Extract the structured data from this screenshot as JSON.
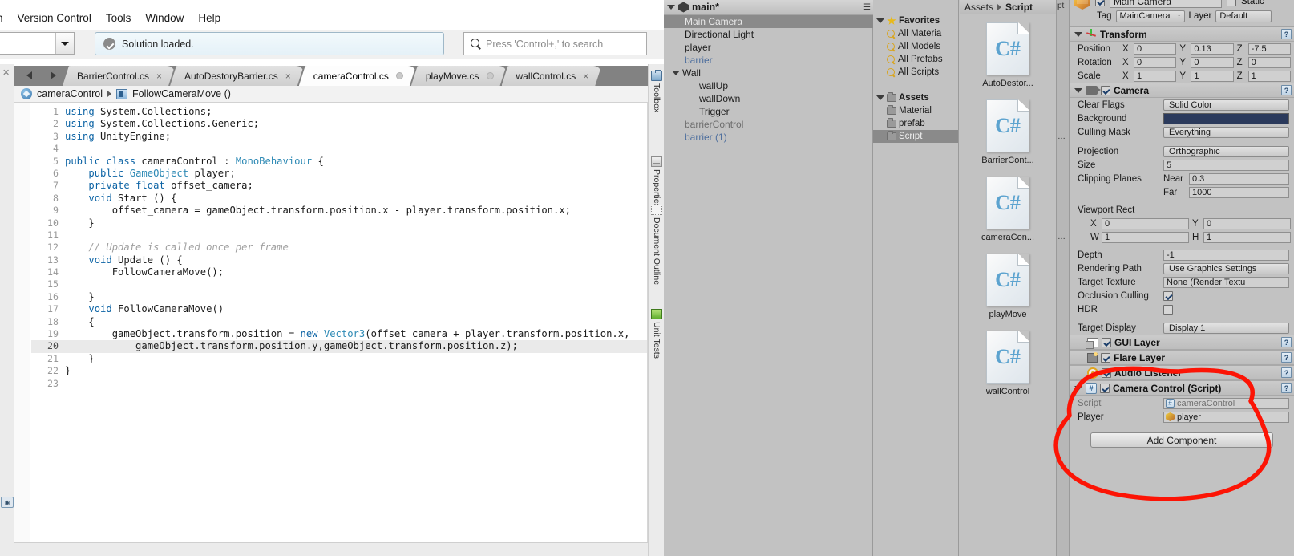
{
  "ide": {
    "menus": [
      "n",
      "Version Control",
      "Tools",
      "Window",
      "Help"
    ],
    "status_text": "Solution loaded.",
    "search_placeholder": "Press 'Control+,' to search",
    "tabs": [
      {
        "label": "BarrierControl.cs",
        "close": "×",
        "active": false,
        "modified": false
      },
      {
        "label": "AutoDestoryBarrier.cs",
        "close": "×",
        "active": false,
        "modified": false
      },
      {
        "label": "cameraControl.cs",
        "close": "",
        "active": true,
        "modified": true
      },
      {
        "label": "playMove.cs",
        "close": "",
        "active": false,
        "modified": true
      },
      {
        "label": "wallControl.cs",
        "close": "×",
        "active": false,
        "modified": false
      }
    ],
    "breadcrumb": {
      "class": "cameraControl",
      "member": "FollowCameraMove ()"
    },
    "dock_tabs": [
      "Toolbox",
      "Properties",
      "Document Outline",
      "Unit Tests"
    ],
    "current_line": 20,
    "code_lines": [
      {
        "n": 1,
        "tokens": [
          {
            "t": "using",
            "c": "kw"
          },
          {
            "t": " System.Collections;",
            "c": ""
          }
        ]
      },
      {
        "n": 2,
        "tokens": [
          {
            "t": "using",
            "c": "kw"
          },
          {
            "t": " System.Collections.Generic;",
            "c": ""
          }
        ]
      },
      {
        "n": 3,
        "tokens": [
          {
            "t": "using",
            "c": "kw"
          },
          {
            "t": " UnityEngine;",
            "c": ""
          }
        ]
      },
      {
        "n": 4,
        "tokens": []
      },
      {
        "n": 5,
        "tokens": [
          {
            "t": "public",
            "c": "kw"
          },
          {
            "t": " ",
            "c": ""
          },
          {
            "t": "class",
            "c": "kw"
          },
          {
            "t": " cameraControl : ",
            "c": ""
          },
          {
            "t": "MonoBehaviour",
            "c": "ty"
          },
          {
            "t": " {",
            "c": ""
          }
        ]
      },
      {
        "n": 6,
        "tokens": [
          {
            "t": "    ",
            "c": ""
          },
          {
            "t": "public",
            "c": "kw"
          },
          {
            "t": " ",
            "c": ""
          },
          {
            "t": "GameObject",
            "c": "ty"
          },
          {
            "t": " player;",
            "c": ""
          }
        ]
      },
      {
        "n": 7,
        "tokens": [
          {
            "t": "    ",
            "c": ""
          },
          {
            "t": "private",
            "c": "kw"
          },
          {
            "t": " ",
            "c": ""
          },
          {
            "t": "float",
            "c": "kw"
          },
          {
            "t": " offset_camera;",
            "c": ""
          }
        ]
      },
      {
        "n": 8,
        "tokens": [
          {
            "t": "    ",
            "c": ""
          },
          {
            "t": "void",
            "c": "kw"
          },
          {
            "t": " Start () {",
            "c": ""
          }
        ]
      },
      {
        "n": 9,
        "tokens": [
          {
            "t": "        offset_camera = gameObject.transform.position.x - player.transform.position.x;",
            "c": ""
          }
        ]
      },
      {
        "n": 10,
        "tokens": [
          {
            "t": "    }",
            "c": ""
          }
        ]
      },
      {
        "n": 11,
        "tokens": []
      },
      {
        "n": 12,
        "tokens": [
          {
            "t": "    // Update is called once per frame",
            "c": "cm"
          }
        ]
      },
      {
        "n": 13,
        "tokens": [
          {
            "t": "    ",
            "c": ""
          },
          {
            "t": "void",
            "c": "kw"
          },
          {
            "t": " Update () {",
            "c": ""
          }
        ]
      },
      {
        "n": 14,
        "tokens": [
          {
            "t": "        FollowCameraMove();",
            "c": ""
          }
        ]
      },
      {
        "n": 15,
        "tokens": []
      },
      {
        "n": 16,
        "tokens": [
          {
            "t": "    }",
            "c": ""
          }
        ]
      },
      {
        "n": 17,
        "tokens": [
          {
            "t": "    ",
            "c": ""
          },
          {
            "t": "void",
            "c": "kw"
          },
          {
            "t": " FollowCameraMove()",
            "c": ""
          }
        ]
      },
      {
        "n": 18,
        "tokens": [
          {
            "t": "    {",
            "c": ""
          }
        ]
      },
      {
        "n": 19,
        "tokens": [
          {
            "t": "        gameObject.transform.position = ",
            "c": ""
          },
          {
            "t": "new",
            "c": "kw"
          },
          {
            "t": " ",
            "c": ""
          },
          {
            "t": "Vector3",
            "c": "ty"
          },
          {
            "t": "(offset_camera + player.transform.position.x,",
            "c": ""
          }
        ]
      },
      {
        "n": 20,
        "tokens": [
          {
            "t": "            gameObject.transform.position.y,gameObject.transform.position.z);",
            "c": ""
          }
        ]
      },
      {
        "n": 21,
        "tokens": [
          {
            "t": "    }",
            "c": ""
          }
        ]
      },
      {
        "n": 22,
        "tokens": [
          {
            "t": "}",
            "c": ""
          }
        ]
      },
      {
        "n": 23,
        "tokens": []
      }
    ]
  },
  "unity": {
    "hierarchy": {
      "scene": "main*",
      "items": [
        {
          "label": "Main Camera",
          "depth": 0,
          "state": "selected",
          "arrow": false
        },
        {
          "label": "Directional Light",
          "depth": 0,
          "state": "normal",
          "arrow": false
        },
        {
          "label": "player",
          "depth": 0,
          "state": "normal",
          "arrow": false
        },
        {
          "label": "barrier",
          "depth": 0,
          "state": "prefab",
          "arrow": false
        },
        {
          "label": "Wall",
          "depth": 0,
          "state": "normal",
          "arrow": true
        },
        {
          "label": "wallUp",
          "depth": 1,
          "state": "normal",
          "arrow": false
        },
        {
          "label": "wallDown",
          "depth": 1,
          "state": "normal",
          "arrow": false
        },
        {
          "label": "Trigger",
          "depth": 1,
          "state": "normal",
          "arrow": false
        },
        {
          "label": "barrierControl",
          "depth": 0,
          "state": "inactive",
          "arrow": false
        },
        {
          "label": "barrier (1)",
          "depth": 0,
          "state": "prefab",
          "arrow": false
        }
      ]
    },
    "project": {
      "tree": [
        {
          "label": "Favorites",
          "icon": "star",
          "bold": true,
          "arrow": true,
          "depth": 0,
          "selected": false
        },
        {
          "label": "All Materia",
          "icon": "search",
          "bold": false,
          "arrow": false,
          "depth": 1,
          "selected": false
        },
        {
          "label": "All Models",
          "icon": "search",
          "bold": false,
          "arrow": false,
          "depth": 1,
          "selected": false
        },
        {
          "label": "All Prefabs",
          "icon": "search",
          "bold": false,
          "arrow": false,
          "depth": 1,
          "selected": false
        },
        {
          "label": "All Scripts",
          "icon": "search",
          "bold": false,
          "arrow": false,
          "depth": 1,
          "selected": false
        },
        {
          "label": "",
          "icon": "none",
          "bold": false,
          "arrow": false,
          "depth": 0,
          "selected": false
        },
        {
          "label": "Assets",
          "icon": "folder",
          "bold": true,
          "arrow": true,
          "depth": 0,
          "selected": false
        },
        {
          "label": "Material",
          "icon": "folder",
          "bold": false,
          "arrow": false,
          "depth": 1,
          "selected": false
        },
        {
          "label": "prefab",
          "icon": "folder",
          "bold": false,
          "arrow": false,
          "depth": 1,
          "selected": false
        },
        {
          "label": "Script",
          "icon": "folder",
          "bold": false,
          "arrow": false,
          "depth": 1,
          "selected": true
        }
      ],
      "breadcrumb": {
        "root": "Assets",
        "current": "Script"
      },
      "assets": [
        {
          "label": "AutoDestor...",
          "glyph": "C#"
        },
        {
          "label": "BarrierCont...",
          "glyph": "C#"
        },
        {
          "label": "cameraCon...",
          "glyph": "C#"
        },
        {
          "label": "playMove",
          "glyph": "C#"
        },
        {
          "label": "wallControl",
          "glyph": "C#"
        }
      ]
    },
    "inspector": {
      "tab_stub": "pt",
      "object_name": "Main Camera",
      "object_enabled": true,
      "static_label": "Static",
      "static_checked": false,
      "tag_label": "Tag",
      "tag_value": "MainCamera",
      "layer_label": "Layer",
      "layer_value": "Default",
      "transform": {
        "title": "Transform",
        "rows": [
          {
            "label": "Position",
            "x": "0",
            "y": "0.13",
            "z": "-7.5"
          },
          {
            "label": "Rotation",
            "x": "0",
            "y": "0",
            "z": "0"
          },
          {
            "label": "Scale",
            "x": "1",
            "y": "1",
            "z": "1"
          }
        ]
      },
      "camera": {
        "title": "Camera",
        "enabled": true,
        "clear_flags_label": "Clear Flags",
        "clear_flags_value": "Solid Color",
        "background_label": "Background",
        "background_color": "#2b3a5c",
        "culling_mask_label": "Culling Mask",
        "culling_mask_value": "Everything",
        "projection_label": "Projection",
        "projection_value": "Orthographic",
        "size_label": "Size",
        "size_value": "5",
        "clipping_label": "Clipping Planes",
        "near_label": "Near",
        "near_value": "0.3",
        "far_label": "Far",
        "far_value": "1000",
        "viewport_label": "Viewport Rect",
        "vp_x_label": "X",
        "vp_x_value": "0",
        "vp_y_label": "Y",
        "vp_y_value": "0",
        "vp_w_label": "W",
        "vp_w_value": "1",
        "vp_h_label": "H",
        "vp_h_value": "1",
        "depth_label": "Depth",
        "depth_value": "-1",
        "rendering_path_label": "Rendering Path",
        "rendering_path_value": "Use Graphics Settings",
        "target_texture_label": "Target Texture",
        "target_texture_value": "None (Render Textu",
        "occlusion_label": "Occlusion Culling",
        "occlusion_checked": true,
        "hdr_label": "HDR",
        "hdr_checked": false,
        "target_display_label": "Target Display",
        "target_display_value": "Display 1"
      },
      "components": [
        {
          "title": "GUI Layer",
          "icon": "gui",
          "enabled": true,
          "foldout": false
        },
        {
          "title": "Flare Layer",
          "icon": "flare",
          "enabled": true,
          "foldout": false
        },
        {
          "title": "Audio Listener",
          "icon": "audio",
          "enabled": true,
          "foldout": false
        },
        {
          "title": "Camera Control (Script)",
          "icon": "script",
          "enabled": true,
          "foldout": true
        }
      ],
      "script_component": {
        "script_label": "Script",
        "script_value": "cameraControl",
        "player_label": "Player",
        "player_value": "player"
      },
      "add_component_label": "Add Component"
    }
  },
  "annotation": {
    "color": "#fc1405",
    "shape": "hand-drawn-oval"
  }
}
